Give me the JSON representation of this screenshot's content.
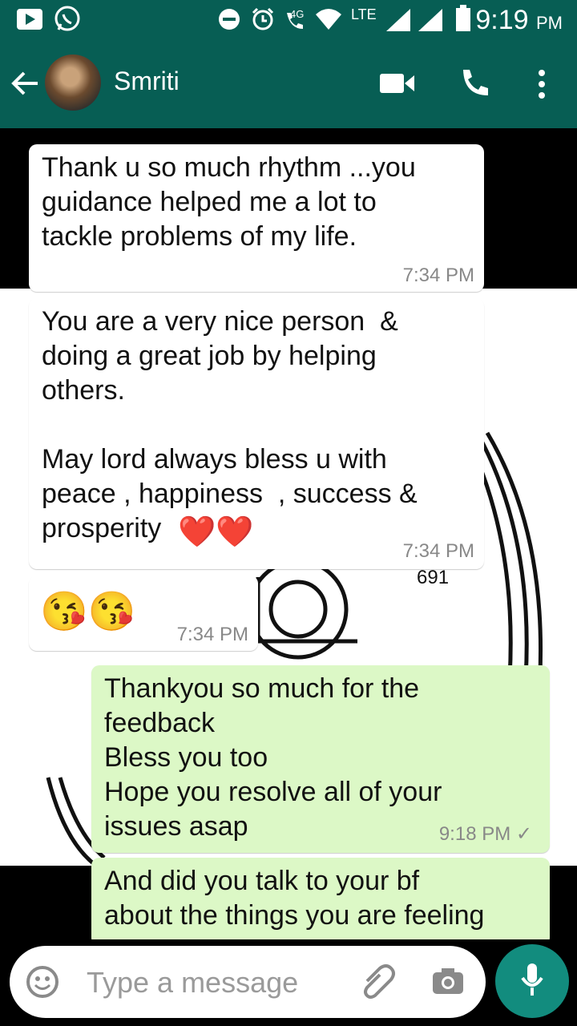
{
  "status_bar": {
    "network_4g": "4G",
    "network_lte": "LTE",
    "time": "9:19",
    "ampm": "PM",
    "icons": [
      "video-app-icon",
      "whatsapp-icon",
      "dnd-icon",
      "alarm-icon",
      "volte-icon",
      "wifi-icon",
      "signal-icon",
      "signal-icon",
      "battery-icon"
    ]
  },
  "header": {
    "contact_name": "Smriti",
    "actions": [
      "back-arrow-icon",
      "video-call-icon",
      "voice-call-icon",
      "more-options-icon"
    ]
  },
  "messages": [
    {
      "direction": "in",
      "text": "Thank u so much rhythm ...you\nguidance helped me a lot to\ntackle problems of my life.",
      "time": "7:34 PM"
    },
    {
      "direction": "in",
      "text": "You are a very nice person  &\ndoing a great job by helping\nothers.\n\nMay lord always bless u with\npeace , happiness  , success &\nprosperity",
      "time": "7:34 PM",
      "emoji": "❤️❤️"
    },
    {
      "direction": "in",
      "emoji": "😘😘",
      "time": "7:34 PM"
    },
    {
      "direction": "out",
      "text": "Thankyou so much for the\nfeedback\nBless you too\nHope you resolve all of your\nissues asap",
      "time": "9:18 PM",
      "status": "✓"
    },
    {
      "direction": "out",
      "text": "And did you talk to your bf\nabout the things you are feeling"
    }
  ],
  "wallpaper_text": "691",
  "composer": {
    "placeholder": "Type a message",
    "icons": [
      "emoji-icon",
      "attach-icon",
      "camera-icon",
      "mic-icon"
    ]
  }
}
